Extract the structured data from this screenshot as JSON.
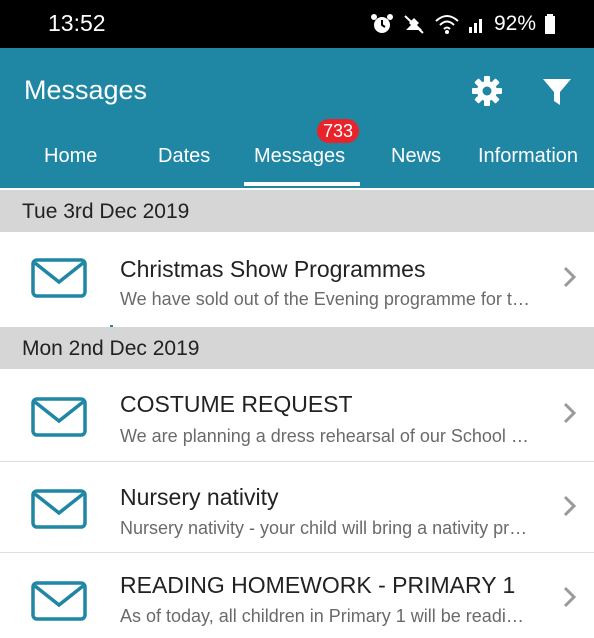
{
  "status_bar": {
    "time": "13:52",
    "battery": "92%",
    "icons": [
      "alarm-icon",
      "mute-icon",
      "wifi-icon",
      "signal-icon",
      "battery-icon"
    ]
  },
  "app_bar": {
    "title": "Messages",
    "background_color": "#1f86a3",
    "actions": [
      "settings-icon",
      "filter-icon"
    ]
  },
  "tabs": [
    {
      "label": "Home"
    },
    {
      "label": "Dates"
    },
    {
      "label": "Messages",
      "active": true,
      "badge": "733"
    },
    {
      "label": "News"
    },
    {
      "label": "Information"
    }
  ],
  "groups": [
    {
      "date": "Tue 3rd Dec 2019",
      "items": [
        {
          "title": "Christmas Show Programmes",
          "preview": "We have sold out of the Evening programme for t…"
        }
      ]
    },
    {
      "date": "Mon 2nd Dec 2019",
      "items": [
        {
          "title": "COSTUME REQUEST",
          "preview": "We are planning a dress rehearsal of our School …"
        },
        {
          "title": "Nursery nativity",
          "preview": "Nursery nativity - your child will bring a nativity pr…"
        },
        {
          "title": "READING HOMEWORK - PRIMARY 1",
          "preview": "As of today, all children in Primary 1 will be readi…"
        }
      ]
    }
  ],
  "colors": {
    "accent": "#1f86a3",
    "badge": "#e8232a",
    "date_header_bg": "#d6d6d6"
  }
}
